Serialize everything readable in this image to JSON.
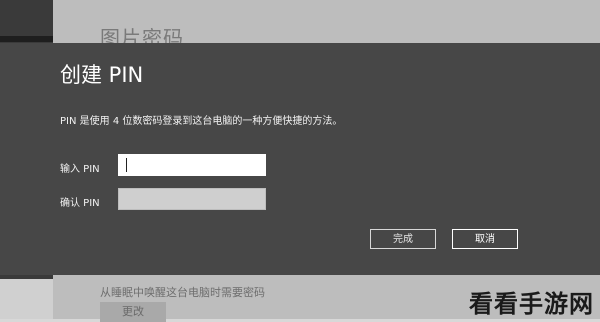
{
  "background": {
    "page_title": "图片密码",
    "hint": "从睡眠中唤醒这台电脑时需要密码",
    "change_button": "更改"
  },
  "dialog": {
    "title": "创建 PIN",
    "description": "PIN 是使用 4 位数密码登录到这台电脑的一种方便快捷的方法。",
    "pin_label": "输入 PIN",
    "pin_value": "",
    "confirm_label": "确认 PIN",
    "confirm_value": "",
    "done_button": "完成",
    "cancel_button": "取消"
  },
  "watermark": "看看手游网"
}
